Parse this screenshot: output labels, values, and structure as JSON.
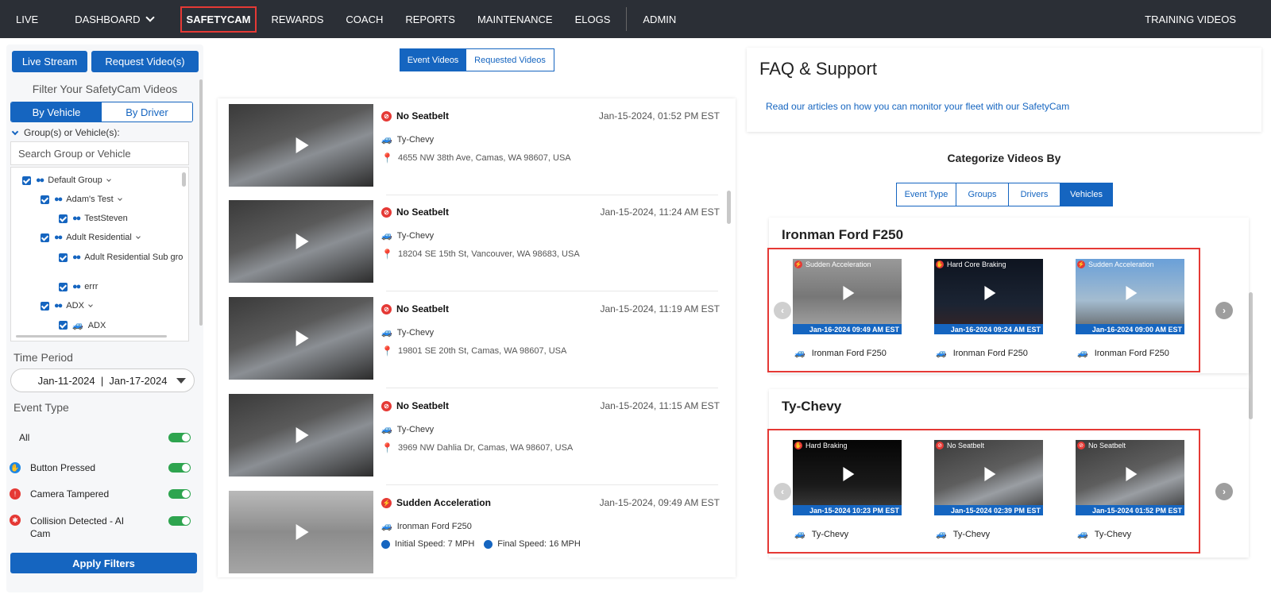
{
  "nav": {
    "items": [
      "LIVE",
      "DASHBOARD",
      "SAFETYCAM",
      "REWARDS",
      "COACH",
      "REPORTS",
      "MAINTENANCE",
      "ELOGS"
    ],
    "admin": "ADMIN",
    "training": "TRAINING VIDEOS"
  },
  "sidebar": {
    "live_stream": "Live Stream",
    "request_video": "Request Video(s)",
    "title": "Filter Your SafetyCam Videos",
    "by_vehicle": "By Vehicle",
    "by_driver": "By Driver",
    "group_label": "Group(s) or Vehicle(s):",
    "search_placeholder": "Search Group or Vehicle",
    "tree": [
      "Default Group",
      "Adam's Test",
      "TestSteven",
      "Adult Residential",
      "Adult Residential Sub gro",
      "errr",
      "ADX",
      "ADX"
    ],
    "time_period_label": "Time Period",
    "time_period_value": "Jan-11-2024  |  Jan-17-2024",
    "event_type_label": "Event Type",
    "events": [
      "All",
      "Button Pressed",
      "Camera Tampered",
      "Collision Detected - AI Cam"
    ],
    "apply": "Apply Filters"
  },
  "center": {
    "tab_event": "Event Videos",
    "tab_requested": "Requested Videos",
    "videos": [
      {
        "event": "No Seatbelt",
        "date": "Jan-15-2024, 01:52 PM EST",
        "vehicle": "Ty-Chevy",
        "address": "4655 NW 38th Ave, Camas, WA 98607, USA"
      },
      {
        "event": "No Seatbelt",
        "date": "Jan-15-2024, 11:24 AM EST",
        "vehicle": "Ty-Chevy",
        "address": "18204 SE 15th St, Vancouver, WA 98683, USA"
      },
      {
        "event": "No Seatbelt",
        "date": "Jan-15-2024, 11:19 AM EST",
        "vehicle": "Ty-Chevy",
        "address": "19801 SE 20th St, Camas, WA 98607, USA"
      },
      {
        "event": "No Seatbelt",
        "date": "Jan-15-2024, 11:15 AM EST",
        "vehicle": "Ty-Chevy",
        "address": "3969 NW Dahlia Dr, Camas, WA 98607, USA"
      },
      {
        "event": "Sudden Acceleration",
        "date": "Jan-15-2024, 09:49 AM EST",
        "vehicle": "Ironman Ford F250",
        "initial_speed": "Initial Speed: 7 MPH",
        "final_speed": "Final Speed: 16 MPH"
      }
    ]
  },
  "right": {
    "faq_title": "FAQ & Support",
    "faq_link": "Read our articles on how you can monitor your fleet with our SafetyCam",
    "categorize_title": "Categorize Videos By",
    "tabs": [
      "Event Type",
      "Groups",
      "Drivers",
      "Vehicles"
    ],
    "cards": [
      {
        "title": "Ironman Ford F250",
        "videos": [
          {
            "event": "Sudden Acceleration",
            "date": "Jan-16-2024 09:49 AM EST",
            "vehicle": "Ironman Ford F250"
          },
          {
            "event": "Hard Core Braking",
            "date": "Jan-16-2024 09:24 AM EST",
            "vehicle": "Ironman Ford F250"
          },
          {
            "event": "Sudden Acceleration",
            "date": "Jan-16-2024 09:00 AM EST",
            "vehicle": "Ironman Ford F250"
          }
        ]
      },
      {
        "title": "Ty-Chevy",
        "videos": [
          {
            "event": "Hard Braking",
            "date": "Jan-15-2024 10:23 PM EST",
            "vehicle": "Ty-Chevy"
          },
          {
            "event": "No Seatbelt",
            "date": "Jan-15-2024 02:39 PM EST",
            "vehicle": "Ty-Chevy"
          },
          {
            "event": "No Seatbelt",
            "date": "Jan-15-2024 01:52 PM EST",
            "vehicle": "Ty-Chevy"
          }
        ]
      }
    ]
  },
  "colors": {
    "brand": "#1565c0",
    "nav_bg": "#2b2f36",
    "alert": "#e53935",
    "toggle_on": "#2ea44f"
  }
}
